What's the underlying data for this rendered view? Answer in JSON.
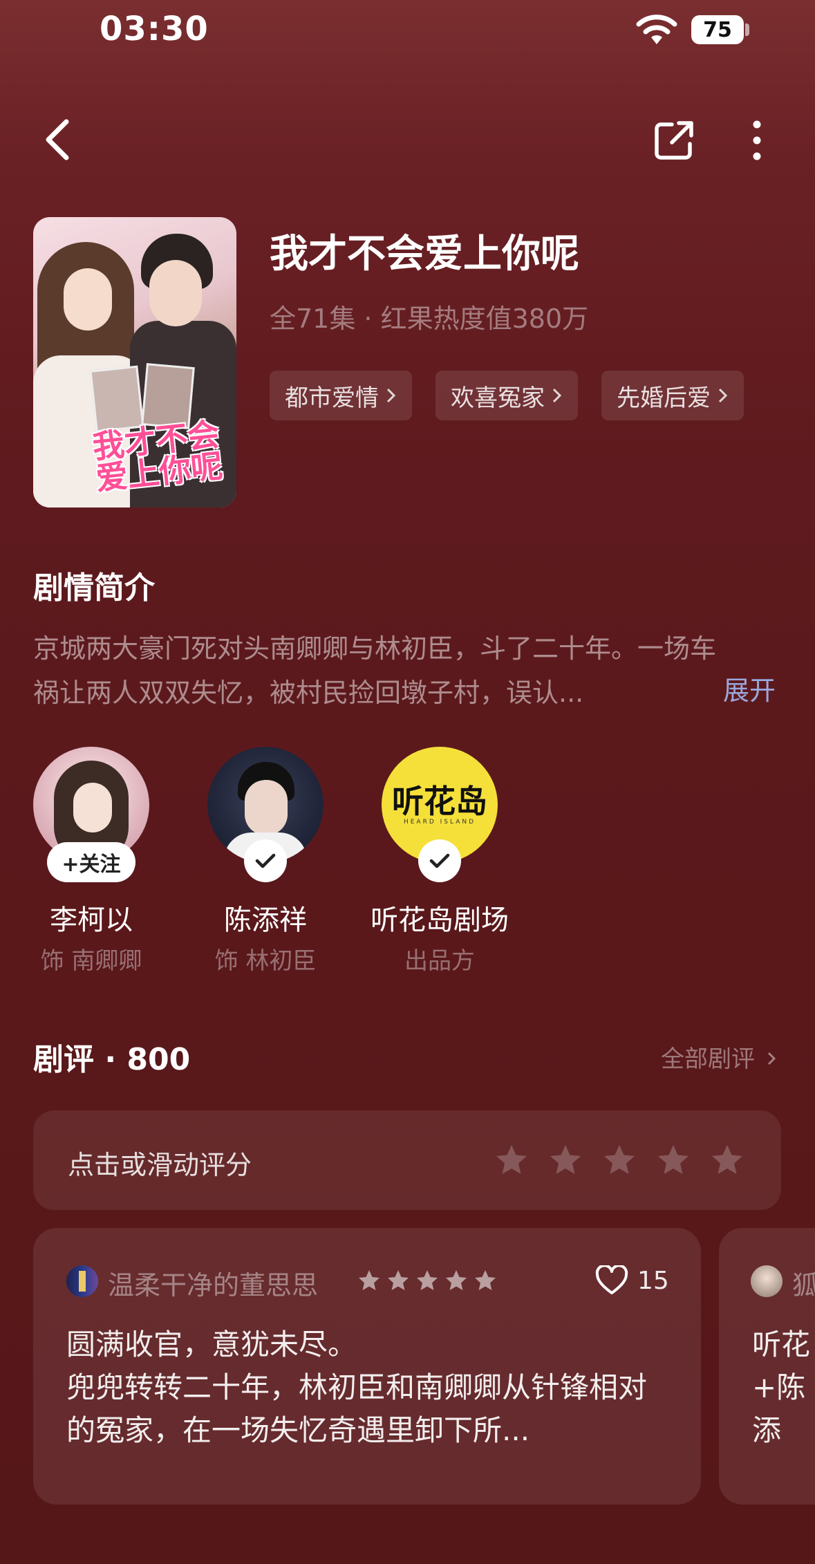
{
  "status_bar": {
    "time": "03:30",
    "battery": "75"
  },
  "drama": {
    "title": "我才不会爱上你呢",
    "meta": "全71集 · 红果热度值380万",
    "poster_text": "我才不会爱上你呢",
    "tags": [
      "都市爱情",
      "欢喜冤家",
      "先婚后爱"
    ]
  },
  "synopsis": {
    "heading": "剧情简介",
    "text": "京城两大豪门死对头南卿卿与林初臣，斗了二十年。一场车祸让两人双双失忆，被村民捡回墩子村，误认...",
    "expand_label": "展开"
  },
  "cast": [
    {
      "name": "李柯以",
      "role": "饰 南卿卿",
      "badge": "+关注"
    },
    {
      "name": "陈添祥",
      "role": "饰 林初臣",
      "badge": "check"
    },
    {
      "name": "听花岛剧场",
      "role": "出品方",
      "badge": "check",
      "logo_text": "听花岛",
      "logo_sub": "HEARD ISLAND"
    }
  ],
  "reviews": {
    "heading": "剧评 · 800",
    "all_label": "全部剧评",
    "rate_prompt": "点击或滑动评分",
    "rate_stars": 5,
    "items": [
      {
        "user": "温柔干净的董思思",
        "stars": 5,
        "likes": "15",
        "text": "圆满收官，意犹未尽。\n兜兜转转二十年，林初臣和南卿卿从针锋相对的冤家，在一场失忆奇遇里卸下所..."
      },
      {
        "user": "狐",
        "text": "听花\n+陈添\n忆变"
      }
    ]
  },
  "colors": {
    "background": "#5e1a1e",
    "accent_link": "#9aa9df",
    "badge_logo": "#f5e03a"
  },
  "icons": [
    "back-arrow-icon",
    "share-icon",
    "more-icon",
    "wifi-icon",
    "check-icon",
    "star-icon",
    "heart-icon"
  ]
}
